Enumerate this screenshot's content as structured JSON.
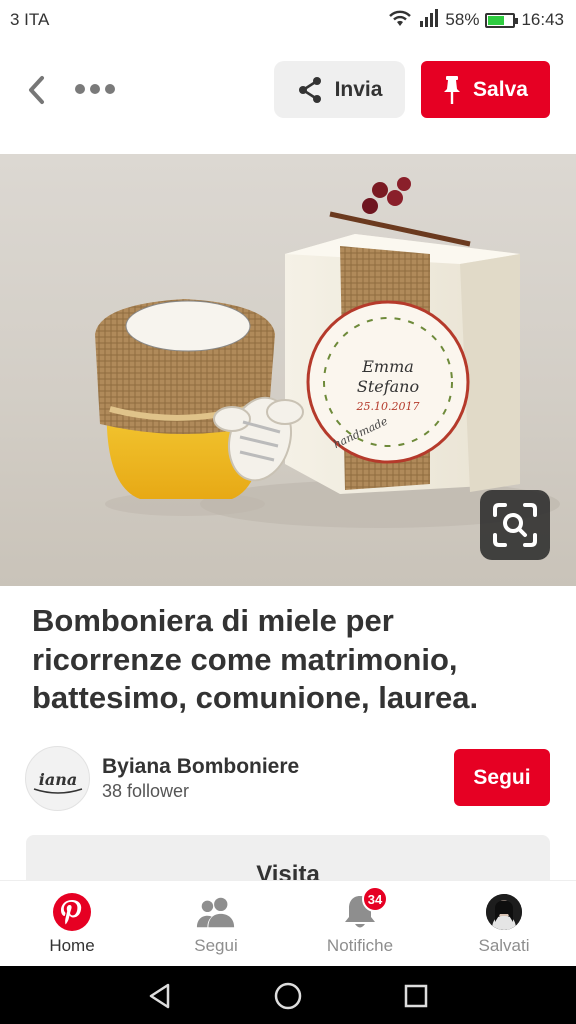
{
  "status_bar": {
    "carrier": "3 ITA",
    "battery_percent": "58%",
    "time": "16:43",
    "icons": [
      "wifi-icon",
      "signal-icon",
      "battery-icon"
    ]
  },
  "toolbar": {
    "share_label": "Invia",
    "save_label": "Salva"
  },
  "pin": {
    "image_label_name1": "Emma",
    "image_label_name2": "Stefano",
    "image_label_date": "25.10.2017",
    "image_label_handmade": "handmade",
    "title": "Bomboniera di miele per ricorrenze come matrimonio, battesimo, comunione, laurea."
  },
  "author": {
    "name": "Byiana Bomboniere",
    "followers": "38 follower",
    "follow_label": "Segui"
  },
  "visit_label": "Visita",
  "bottom_nav": {
    "items": [
      {
        "label": "Home",
        "icon": "pinterest-logo-icon",
        "active": true
      },
      {
        "label": "Segui",
        "icon": "people-icon"
      },
      {
        "label": "Notifiche",
        "icon": "bell-icon",
        "badge": "34"
      },
      {
        "label": "Salvati",
        "icon": "profile-avatar"
      }
    ]
  },
  "colors": {
    "brand_red": "#e60023",
    "secondary_button": "#efefef",
    "text": "#333333"
  }
}
